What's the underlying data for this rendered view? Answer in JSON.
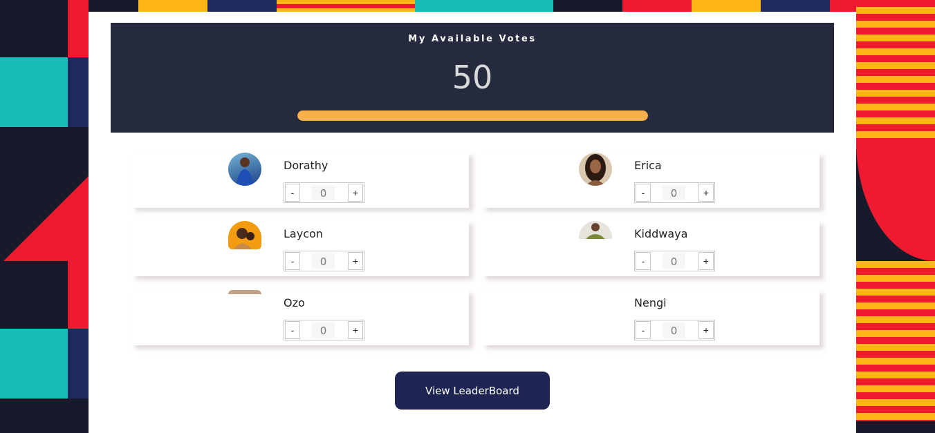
{
  "votes": {
    "title": "My Available Votes",
    "count": "50",
    "progress_fraction": 1.0,
    "progress_color": "#f6b14c"
  },
  "contestants": [
    {
      "name": "Dorathy",
      "votes": "0",
      "avatar": "dorathy-photo"
    },
    {
      "name": "Erica",
      "votes": "0",
      "avatar": "erica-photo"
    },
    {
      "name": "Laycon",
      "votes": "0",
      "avatar": "laycon-photo"
    },
    {
      "name": "Kiddwaya",
      "votes": "0",
      "avatar": "kiddwaya-photo"
    },
    {
      "name": "Ozo",
      "votes": "0",
      "avatar": "ozo-photo"
    },
    {
      "name": "Nengi",
      "votes": "0",
      "avatar": "nengi-photo"
    }
  ],
  "stepper": {
    "minus": "-",
    "plus": "+"
  },
  "leaderboard_button": "View LeaderBoard",
  "colors": {
    "header_bg": "#252a3e",
    "button_bg": "#1e2553",
    "accent_red": "#ef1a2f",
    "accent_teal": "#15bdb6",
    "accent_yellow": "#fdb614",
    "accent_navy": "#1e2a5e"
  }
}
